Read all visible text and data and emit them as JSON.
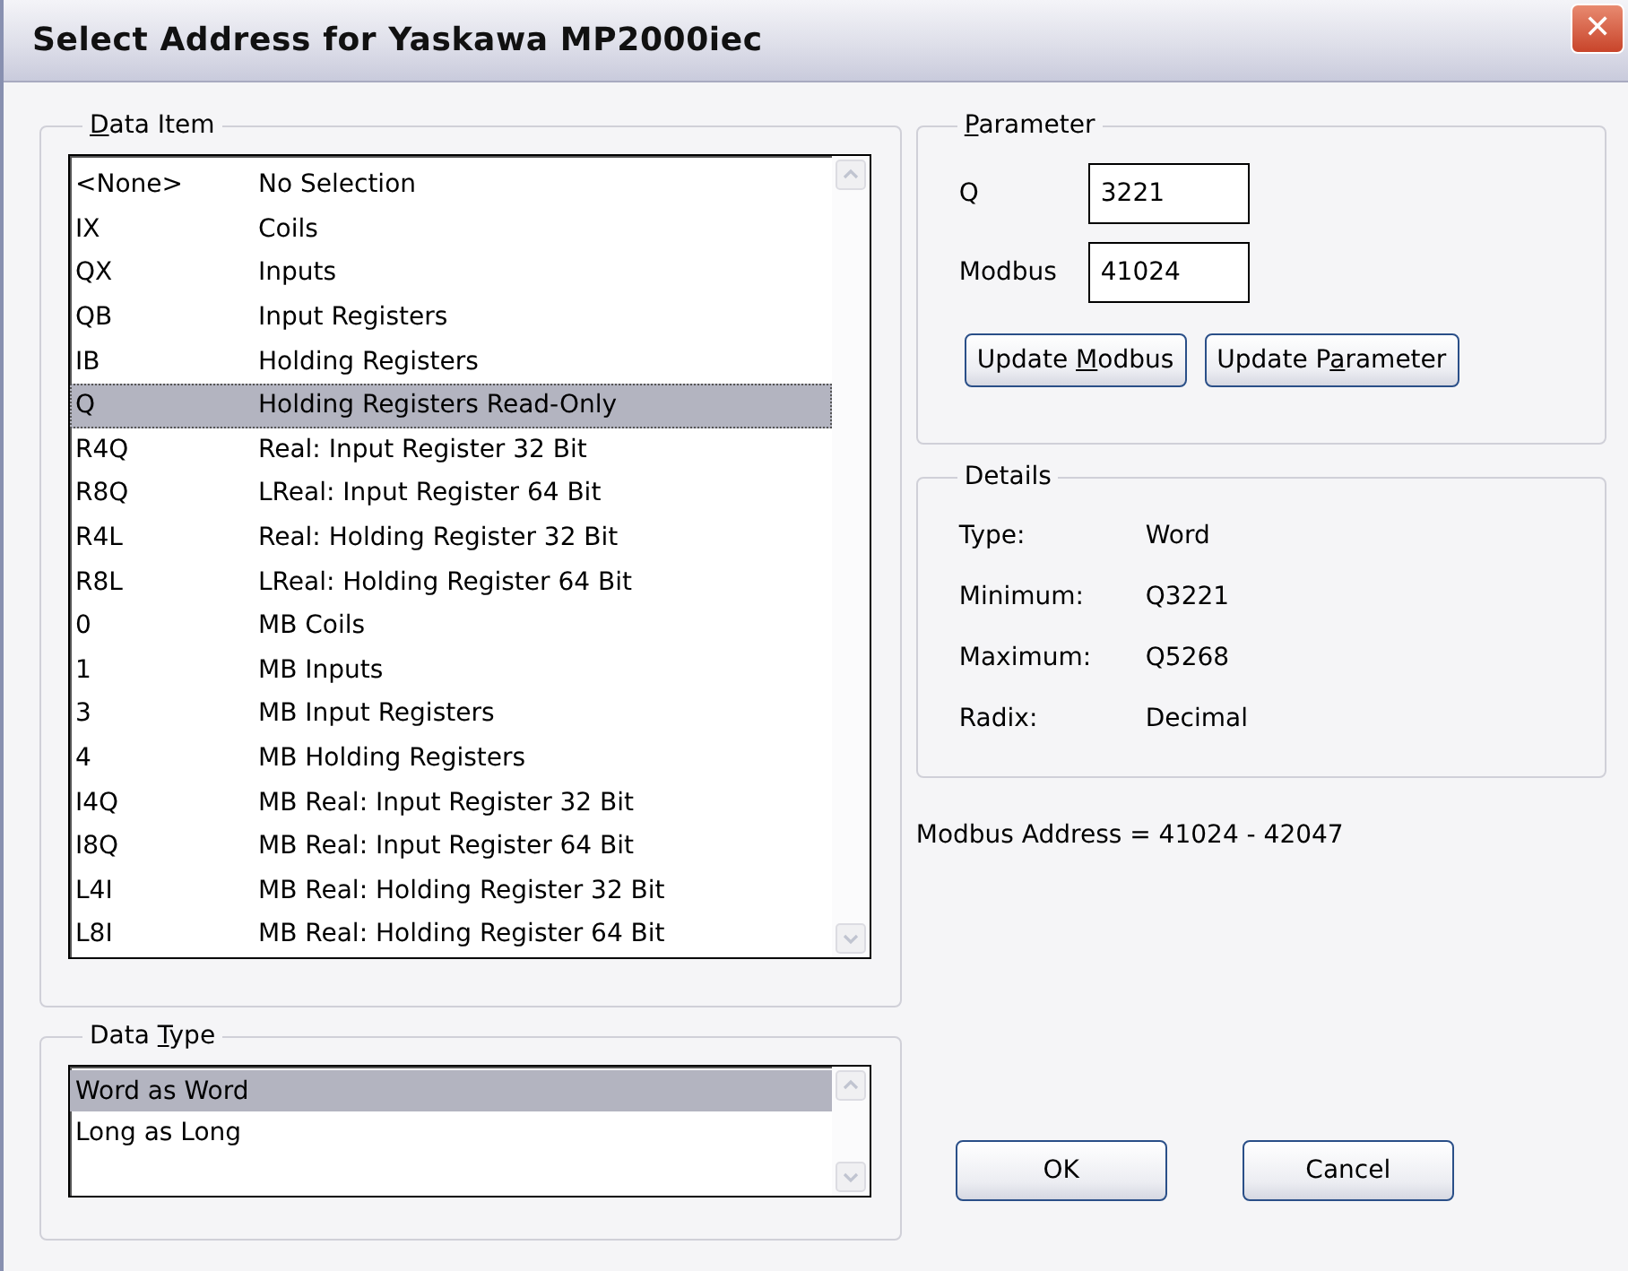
{
  "window": {
    "title": "Select Address for Yaskawa MP2000iec",
    "close": "✕"
  },
  "data_item": {
    "title": {
      "access_key": "D",
      "after": "ata Item"
    },
    "items": [
      {
        "code": "<None>",
        "description": "No Selection",
        "selected": false
      },
      {
        "code": "IX",
        "description": "Coils",
        "selected": false
      },
      {
        "code": "QX",
        "description": "Inputs",
        "selected": false
      },
      {
        "code": "QB",
        "description": "Input Registers",
        "selected": false
      },
      {
        "code": "IB",
        "description": "Holding Registers",
        "selected": false
      },
      {
        "code": "Q",
        "description": "Holding Registers Read-Only",
        "selected": true
      },
      {
        "code": "R4Q",
        "description": "Real:  Input Register 32 Bit",
        "selected": false
      },
      {
        "code": "R8Q",
        "description": "LReal: Input Register 64 Bit",
        "selected": false
      },
      {
        "code": "R4L",
        "description": "Real:  Holding Register 32 Bit",
        "selected": false
      },
      {
        "code": "R8L",
        "description": "LReal: Holding Register 64 Bit",
        "selected": false
      },
      {
        "code": "0",
        "description": "MB Coils",
        "selected": false
      },
      {
        "code": "1",
        "description": "MB Inputs",
        "selected": false
      },
      {
        "code": "3",
        "description": "MB Input Registers",
        "selected": false
      },
      {
        "code": "4",
        "description": "MB Holding Registers",
        "selected": false
      },
      {
        "code": "I4Q",
        "description": "MB Real: Input Register 32 Bit",
        "selected": false
      },
      {
        "code": "I8Q",
        "description": "MB Real: Input Register 64 Bit",
        "selected": false
      },
      {
        "code": "L4I",
        "description": "MB Real: Holding Register 32 Bit",
        "selected": false
      },
      {
        "code": "L8I",
        "description": "MB Real: Holding Register 64 Bit",
        "selected": false
      }
    ]
  },
  "data_type": {
    "title": {
      "before": "Data ",
      "access_key": "T",
      "after": "ype"
    },
    "items": [
      {
        "label": "Word as Word",
        "selected": true
      },
      {
        "label": "Long as Long",
        "selected": false
      }
    ]
  },
  "parameter": {
    "title": {
      "access_key": "P",
      "after": "arameter"
    },
    "fields": [
      {
        "label": "Q",
        "value": "3221"
      },
      {
        "label": "Modbus",
        "value": "41024"
      }
    ],
    "buttons": [
      {
        "label": {
          "before": "Update ",
          "access_key": "M",
          "after": "odbus"
        }
      },
      {
        "label": {
          "before": "Update P",
          "access_key": "a",
          "after": "rameter"
        }
      }
    ]
  },
  "details": {
    "title": "Details",
    "rows": [
      {
        "label": "Type:",
        "value": "Word"
      },
      {
        "label": "Minimum:",
        "value": "Q3221"
      },
      {
        "label": "Maximum:",
        "value": "Q5268"
      },
      {
        "label": "Radix:",
        "value": "Decimal"
      }
    ]
  },
  "modbus_address": "Modbus Address = 41024 - 42047",
  "buttons": [
    {
      "label": "OK"
    },
    {
      "label": "Cancel"
    }
  ]
}
